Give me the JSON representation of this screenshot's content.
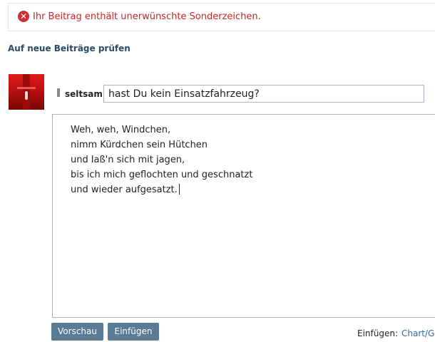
{
  "error": {
    "message": "Ihr Beitrag enthält unerwünschte Sonderzeichen.",
    "icon": "error-circle-icon",
    "color": "#c62828"
  },
  "check_new_posts": "Auf neue Beiträge prüfen",
  "reply": {
    "speaker": "seltsam:",
    "title_value": "hast Du kein Einsatzfahrzeug?",
    "body_lines": [
      "Weh, weh, Windchen,",
      "nimm Kürdchen sein Hütchen",
      "und laß'n sich mit jagen,",
      "bis ich mich geflochten und geschnatzt",
      "und wieder aufgesatzt."
    ]
  },
  "buttons": {
    "preview": "Vorschau",
    "insert": "Einfügen"
  },
  "insert": {
    "label": "Einfügen:",
    "link": "Chart/Gr"
  },
  "colors": {
    "button_bg": "#5b7a93",
    "link": "#2a4a6a",
    "input_border": "#a7b4c4"
  }
}
